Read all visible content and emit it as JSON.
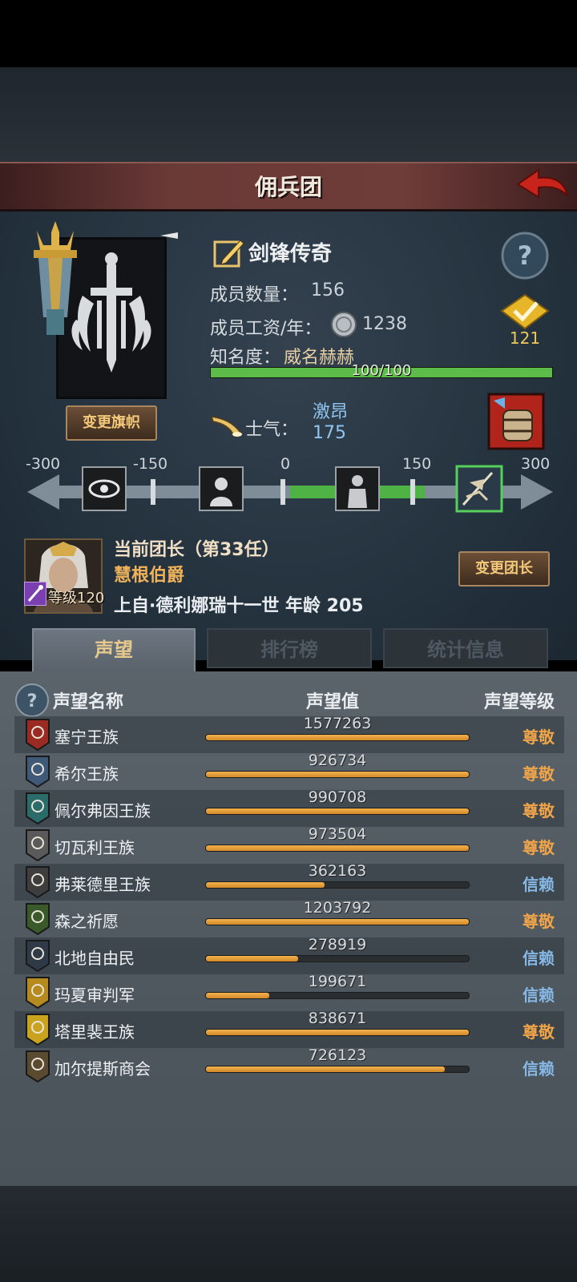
{
  "header": {
    "title": "佣兵团"
  },
  "guild": {
    "name": "剑锋传奇",
    "members_label": "成员数量：",
    "members_value": "156",
    "wage_label": "成员工资/年：",
    "wage_value": "1238",
    "fame_label": "知名度：",
    "fame_value": "威名赫赫",
    "fame_progress_text": "100/100",
    "fame_progress": 1.0,
    "rank_number": "121",
    "change_flag_label": "变更旗帜"
  },
  "morale": {
    "label": "士气：",
    "word": "激昂",
    "value": "175",
    "scale_ticks": [
      "-300",
      "-150",
      "0",
      "150",
      "300"
    ],
    "scale_value": 175
  },
  "leader": {
    "heading": "当前团长（第33任）",
    "title": "慧根伯爵",
    "name_line": "上自·德利娜瑞十一世  年龄  205",
    "level": "等级120",
    "change_leader_label": "变更团长"
  },
  "tabs": [
    "声望",
    "排行榜",
    "统计信息"
  ],
  "table": {
    "headers": [
      "声望名称",
      "声望值",
      "声望等级"
    ],
    "rows": [
      {
        "name": "塞宁王族",
        "value": "1577263",
        "level": "尊敬",
        "fill": 1.0,
        "color": "#9b2b22"
      },
      {
        "name": "希尔王族",
        "value": "926734",
        "level": "尊敬",
        "fill": 1.0,
        "color": "#3f5a78"
      },
      {
        "name": "佩尔弗因王族",
        "value": "990708",
        "level": "尊敬",
        "fill": 1.0,
        "color": "#2b6b6a"
      },
      {
        "name": "切瓦利王族",
        "value": "973504",
        "level": "尊敬",
        "fill": 1.0,
        "color": "#5a5a5a"
      },
      {
        "name": "弗莱德里王族",
        "value": "362163",
        "level": "信赖",
        "fill": 0.45,
        "color": "#3e3e3e"
      },
      {
        "name": "森之祈愿",
        "value": "1203792",
        "level": "尊敬",
        "fill": 1.0,
        "color": "#3b5a2a"
      },
      {
        "name": "北地自由民",
        "value": "278919",
        "level": "信赖",
        "fill": 0.35,
        "color": "#2e3a48"
      },
      {
        "name": "玛夏审判军",
        "value": "199671",
        "level": "信赖",
        "fill": 0.24,
        "color": "#b58a1e"
      },
      {
        "name": "塔里裴王族",
        "value": "838671",
        "level": "尊敬",
        "fill": 1.0,
        "color": "#c9a21e"
      },
      {
        "name": "加尔提斯商会",
        "value": "726123",
        "level": "信赖",
        "fill": 0.91,
        "color": "#5a4a30"
      }
    ]
  },
  "colors": {
    "respect": "#f0a44a",
    "trust": "#86b8e6",
    "accent_green": "#5dbb4a"
  }
}
